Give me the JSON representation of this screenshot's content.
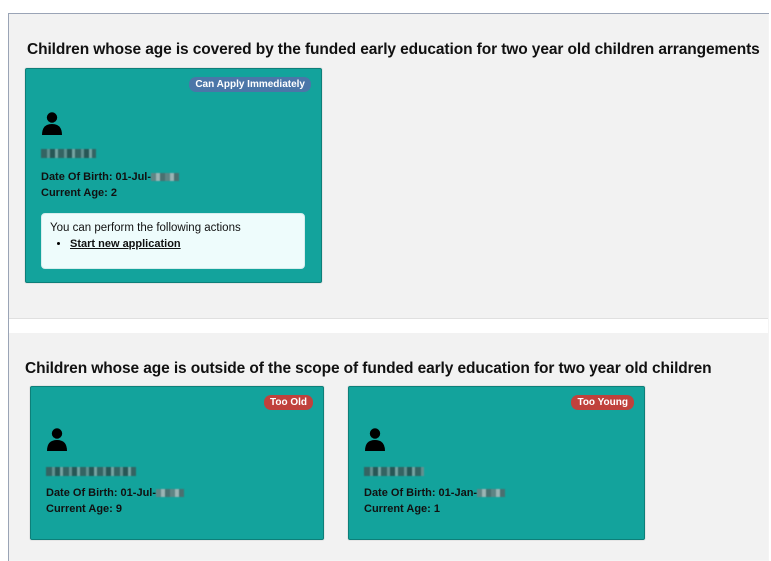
{
  "section1": {
    "heading": "Children whose age is covered by the funded early education for two year old children arrangements",
    "child": {
      "badge": "Can Apply Immediately",
      "dob_label": "Date Of Birth: 01-Jul-",
      "age_label": "Current Age: 2",
      "actions_intro": "You can perform the following actions",
      "action_link": "Start new application"
    }
  },
  "section2": {
    "heading": "Children whose age is outside of the scope of funded early education for two year old children",
    "children": [
      {
        "badge": "Too Old",
        "dob_label": "Date Of Birth: 01-Jul-",
        "age_label": "Current Age: 9"
      },
      {
        "badge": "Too Young",
        "dob_label": "Date Of Birth: 01-Jan-",
        "age_label": "Current Age: 1"
      }
    ]
  },
  "colors": {
    "card": "#13a39c",
    "badge_apply": "#4b76a8",
    "badge_ineligible": "#c0413c"
  },
  "icons": [
    "person-icon"
  ]
}
